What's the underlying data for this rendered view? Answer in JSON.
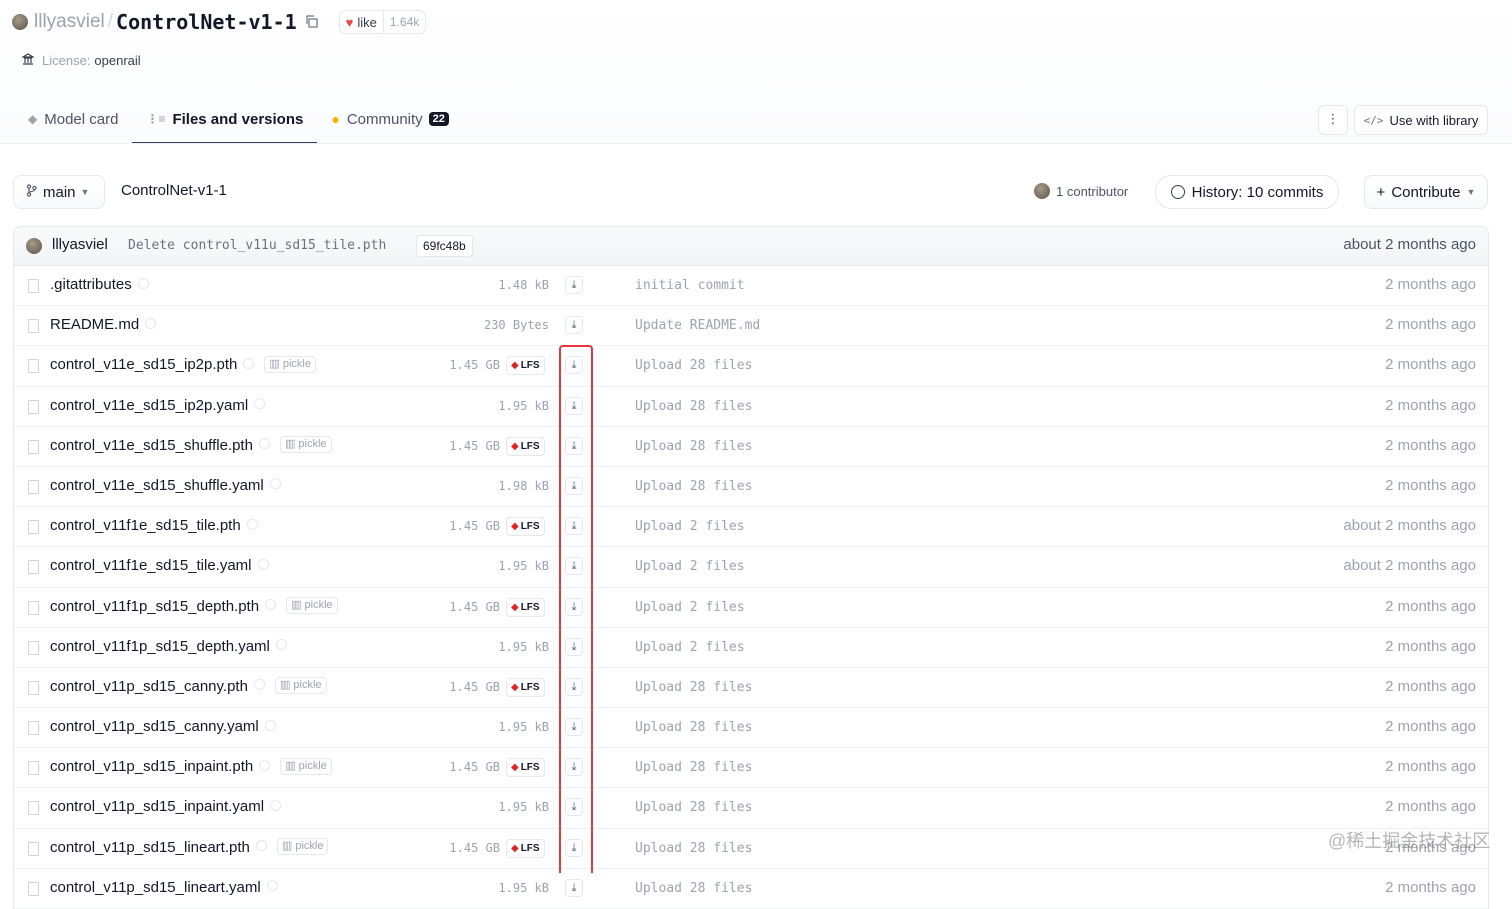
{
  "repo": {
    "owner": "lllyasviel",
    "separator": "/",
    "name": "ControlNet-v1-1",
    "like_label": "like",
    "like_count": "1.64k",
    "license_label": "License:",
    "license_value": "openrail"
  },
  "tabs": [
    {
      "label": "Model card",
      "active": false
    },
    {
      "label": "Files and versions",
      "active": true
    },
    {
      "label": "Community",
      "active": false,
      "badge": "22"
    }
  ],
  "actions": {
    "more": "⋮",
    "use_with_library": "Use with library"
  },
  "branch": {
    "name": "main",
    "path": "ControlNet-v1-1",
    "contributors": "1 contributor",
    "history": "History: 10 commits",
    "contribute": "Contribute"
  },
  "last_commit": {
    "author": "lllyasviel",
    "message": "Delete control_v11u_sd15_tile.pth",
    "sha": "69fc48b",
    "when": "about 2 months ago"
  },
  "files": [
    {
      "name": ".gitattributes",
      "size": "1.48 kB",
      "lfs": false,
      "pickle": false,
      "commit": "initial commit",
      "when": "2 months ago"
    },
    {
      "name": "README.md",
      "size": "230 Bytes",
      "lfs": false,
      "pickle": false,
      "commit": "Update README.md",
      "when": "2 months ago"
    },
    {
      "name": "control_v11e_sd15_ip2p.pth",
      "size": "1.45 GB",
      "lfs": true,
      "pickle": true,
      "commit": "Upload 28 files",
      "when": "2 months ago"
    },
    {
      "name": "control_v11e_sd15_ip2p.yaml",
      "size": "1.95 kB",
      "lfs": false,
      "pickle": false,
      "commit": "Upload 28 files",
      "when": "2 months ago"
    },
    {
      "name": "control_v11e_sd15_shuffle.pth",
      "size": "1.45 GB",
      "lfs": true,
      "pickle": true,
      "commit": "Upload 28 files",
      "when": "2 months ago"
    },
    {
      "name": "control_v11e_sd15_shuffle.yaml",
      "size": "1.98 kB",
      "lfs": false,
      "pickle": false,
      "commit": "Upload 28 files",
      "when": "2 months ago"
    },
    {
      "name": "control_v11f1e_sd15_tile.pth",
      "size": "1.45 GB",
      "lfs": true,
      "pickle": false,
      "commit": "Upload 2 files",
      "when": "about 2 months ago"
    },
    {
      "name": "control_v11f1e_sd15_tile.yaml",
      "size": "1.95 kB",
      "lfs": false,
      "pickle": false,
      "commit": "Upload 2 files",
      "when": "about 2 months ago"
    },
    {
      "name": "control_v11f1p_sd15_depth.pth",
      "size": "1.45 GB",
      "lfs": true,
      "pickle": true,
      "commit": "Upload 2 files",
      "when": "2 months ago"
    },
    {
      "name": "control_v11f1p_sd15_depth.yaml",
      "size": "1.95 kB",
      "lfs": false,
      "pickle": false,
      "commit": "Upload 2 files",
      "when": "2 months ago"
    },
    {
      "name": "control_v11p_sd15_canny.pth",
      "size": "1.45 GB",
      "lfs": true,
      "pickle": true,
      "commit": "Upload 28 files",
      "when": "2 months ago"
    },
    {
      "name": "control_v11p_sd15_canny.yaml",
      "size": "1.95 kB",
      "lfs": false,
      "pickle": false,
      "commit": "Upload 28 files",
      "when": "2 months ago"
    },
    {
      "name": "control_v11p_sd15_inpaint.pth",
      "size": "1.45 GB",
      "lfs": true,
      "pickle": true,
      "commit": "Upload 28 files",
      "when": "2 months ago"
    },
    {
      "name": "control_v11p_sd15_inpaint.yaml",
      "size": "1.95 kB",
      "lfs": false,
      "pickle": false,
      "commit": "Upload 28 files",
      "when": "2 months ago"
    },
    {
      "name": "control_v11p_sd15_lineart.pth",
      "size": "1.45 GB",
      "lfs": true,
      "pickle": true,
      "commit": "Upload 28 files",
      "when": "2 months ago"
    },
    {
      "name": "control_v11p_sd15_lineart.yaml",
      "size": "1.95 kB",
      "lfs": false,
      "pickle": false,
      "commit": "Upload 28 files",
      "when": "2 months ago"
    }
  ],
  "labels": {
    "pickle": "pickle",
    "lfs": "LFS",
    "download_icon": "download-icon"
  },
  "watermark": "@稀土掘金技术社区",
  "colors": {
    "highlight": "#e23b3b",
    "lfs_cube": "#dc2626",
    "heart": "#ef4444"
  }
}
